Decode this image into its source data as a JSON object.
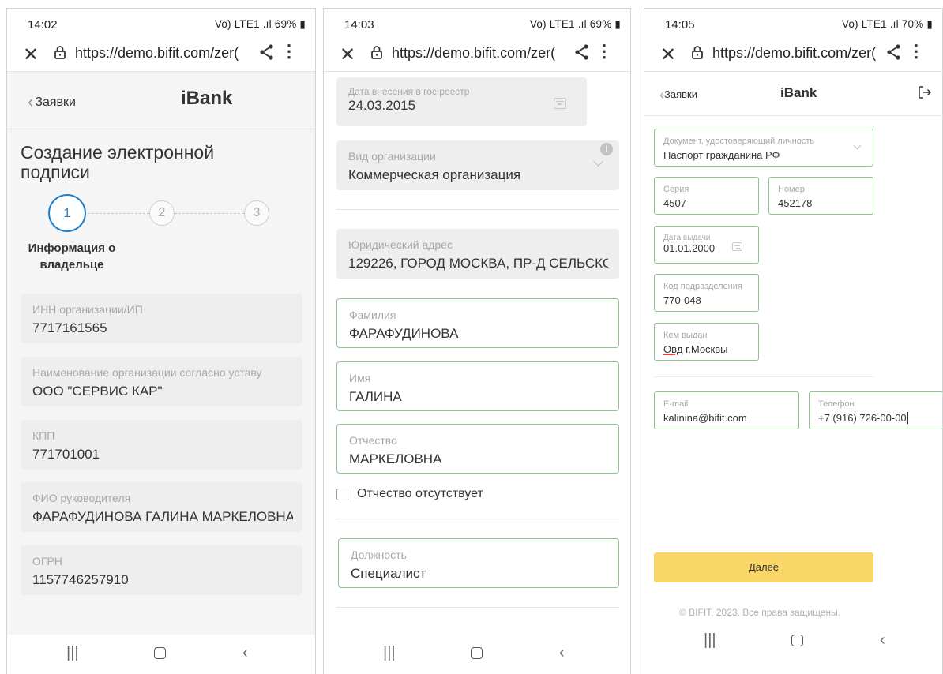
{
  "phone1": {
    "status": {
      "time": "14:02",
      "battery": "69%",
      "signal": "Vo) LTE1 .ıl"
    },
    "browser": {
      "url": "https://demo.bifit.com/zer("
    },
    "nav": {
      "back_label": "Заявки",
      "title": "iBank"
    },
    "heading": [
      "Создание электронной",
      "подписи"
    ],
    "steps": [
      "1",
      "2",
      "3"
    ],
    "step_label": [
      "Информация о",
      "владельце"
    ],
    "fields": [
      {
        "label": "ИНН организации/ИП",
        "value": "7717161565"
      },
      {
        "label": "Наименование организации согласно уставу",
        "value": "ООО \"СЕРВИС КАР\""
      },
      {
        "label": "КПП",
        "value": "771701001"
      },
      {
        "label": "ФИО руководителя",
        "value": "ФАРАФУДИНОВА ГАЛИНА МАРКЕЛОВНА"
      },
      {
        "label": "ОГРН",
        "value": "1157746257910"
      }
    ]
  },
  "phone2": {
    "status": {
      "time": "14:03",
      "battery": "69%",
      "signal": "Vo) LTE1 .ıl"
    },
    "browser": {
      "url": "https://demo.bifit.com/zer("
    },
    "fields": {
      "reg_date": {
        "label": "Дата внесения в гос.реестр",
        "value": "24.03.2015"
      },
      "org_type": {
        "label": "Вид организации",
        "value": "Коммерческая организация"
      },
      "legal_address": {
        "label": "Юридический адрес",
        "value": "129226, ГОРОД МОСКВА, ПР-Д СЕЛЬСКОХС"
      },
      "last_name": {
        "label": "Фамилия",
        "value": "ФАРАФУДИНОВА"
      },
      "first_name": {
        "label": "Имя",
        "value": "ГАЛИНА"
      },
      "patronymic": {
        "label": "Отчество",
        "value": "МАРКЕЛОВНА"
      },
      "position": {
        "label": "Должность",
        "value": "Специалист"
      }
    },
    "no_patronymic_label": "Отчество отсутствует",
    "no_patronymic_checked": false
  },
  "phone3": {
    "status": {
      "time": "14:05",
      "battery": "70%",
      "signal": "Vo) LTE1 .ıl"
    },
    "browser": {
      "url": "https://demo.bifit.com/zer("
    },
    "nav": {
      "back_label": "Заявки",
      "title": "iBank"
    },
    "fields": {
      "doc": {
        "label": "Документ, удостоверяющий личность",
        "value": "Паспорт гражданина РФ"
      },
      "series": {
        "label": "Серия",
        "value": "4507"
      },
      "number": {
        "label": "Номер",
        "value": "452178"
      },
      "issue_date": {
        "label": "Дата выдачи",
        "value": "01.01.2000"
      },
      "dept_code": {
        "label": "Код подразделения",
        "value": "770-048"
      },
      "issued_by": {
        "label": "Кем выдан",
        "value_err": "Овд",
        "value_rest": " г.Москвы"
      },
      "email": {
        "label": "E-mail",
        "value": "kalinina@bifit.com"
      },
      "phone": {
        "label": "Телефон",
        "value": "+7 (916) 726-00-00"
      }
    },
    "next_button": "Далее",
    "copyright": "© BIFIT, 2023. Все права защищены."
  }
}
